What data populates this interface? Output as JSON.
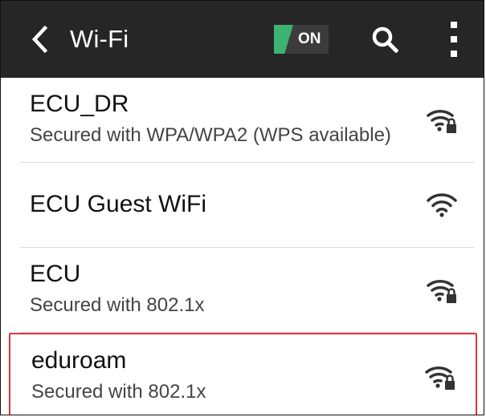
{
  "header": {
    "title": "Wi-Fi",
    "toggle_label": "ON"
  },
  "networks": [
    {
      "name": "ECU_DR",
      "status": "Secured with WPA/WPA2 (WPS available)",
      "icon": "wifi-locked-icon"
    },
    {
      "name": "ECU Guest WiFi",
      "status": "",
      "icon": "wifi-open-icon"
    },
    {
      "name": "ECU",
      "status": "Secured with 802.1x",
      "icon": "wifi-locked-icon"
    },
    {
      "name": "eduroam",
      "status": "Secured with 802.1x",
      "icon": "wifi-locked-icon"
    }
  ],
  "colors": {
    "header_bg": "#262626",
    "toggle_on": "#3cb371",
    "highlight": "#e0333d"
  }
}
